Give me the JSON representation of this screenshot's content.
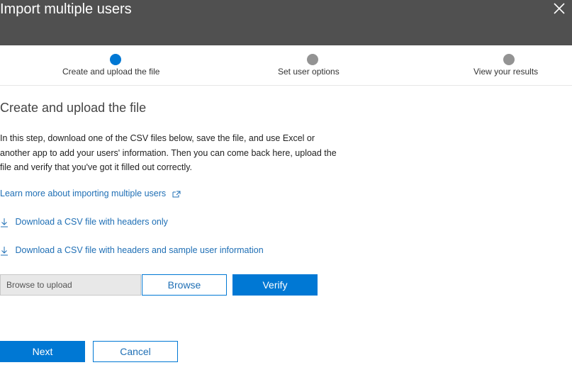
{
  "header": {
    "title": "Import multiple users",
    "close_icon": "close-icon"
  },
  "stepper": {
    "steps": [
      {
        "label": "Create and upload the file",
        "active": true
      },
      {
        "label": "Set user options",
        "active": false
      },
      {
        "label": "View your results",
        "active": false
      }
    ],
    "active_color": "#0078d4",
    "inactive_color": "#939393"
  },
  "main": {
    "title": "Create and upload the file",
    "description": "In this step, download one of the CSV files below, save the file, and use Excel or another app to add your users' information. Then you can come back here, upload the file and verify that you've got it filled out correctly.",
    "learn_more": {
      "label": "Learn more about importing multiple users",
      "icon": "external-link-icon"
    },
    "downloads": [
      {
        "label": "Download a CSV file with headers only",
        "icon": "download-icon"
      },
      {
        "label": "Download a CSV file with headers and sample user information",
        "icon": "download-icon"
      }
    ],
    "upload": {
      "placeholder": "Browse to upload",
      "browse_label": "Browse",
      "verify_label": "Verify"
    }
  },
  "footer": {
    "next_label": "Next",
    "cancel_label": "Cancel"
  },
  "colors": {
    "header_bg": "#505050",
    "primary": "#0078d4",
    "link": "#1f6fb5"
  }
}
